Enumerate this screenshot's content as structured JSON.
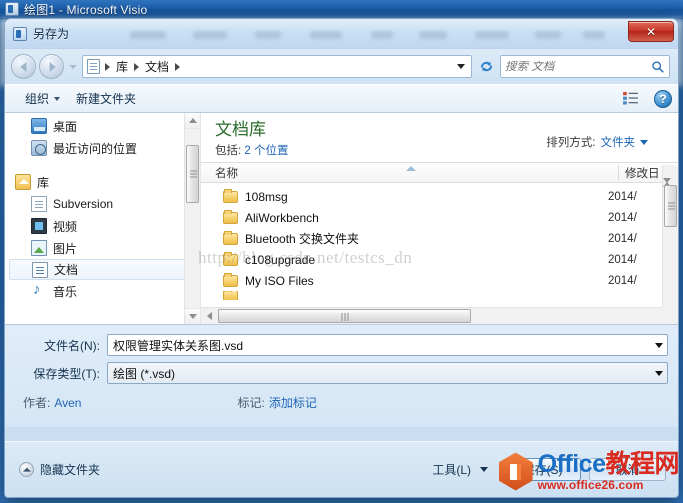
{
  "background_window": {
    "title": "绘图1 - Microsoft Visio",
    "icon": "visio-app-icon"
  },
  "dialog": {
    "title": "另存为",
    "icon": "visio-app-icon",
    "close_label": "✕"
  },
  "navbar": {
    "back_icon": "back-arrow-icon",
    "forward_icon": "forward-arrow-icon",
    "history_icon": "chevron-down-icon",
    "path_icon": "library-document-icon",
    "breadcrumbs": [
      "库",
      "文档"
    ],
    "dropdown_icon": "chevron-down-icon",
    "refresh_icon": "refresh-icon",
    "search": {
      "placeholder": "搜索 文档",
      "value": "",
      "icon": "search-icon"
    }
  },
  "commandbar": {
    "organize_label": "组织",
    "new_folder_label": "新建文件夹",
    "view_icon": "view-layout-icon",
    "view_caret_icon": "chevron-down-icon",
    "help_label": "?",
    "help_icon": "help-icon"
  },
  "sidebar": {
    "items": [
      {
        "label": "桌面",
        "icon": "desktop-icon",
        "type": "item",
        "selected": false
      },
      {
        "label": "最近访问的位置",
        "icon": "recent-places-icon",
        "type": "item",
        "selected": false
      },
      {
        "label": "",
        "icon": "",
        "type": "spacer",
        "selected": false
      },
      {
        "label": "库",
        "icon": "library-icon",
        "type": "group",
        "selected": false
      },
      {
        "label": "Subversion",
        "icon": "subversion-icon",
        "type": "item",
        "selected": false
      },
      {
        "label": "视频",
        "icon": "video-icon",
        "type": "item",
        "selected": false
      },
      {
        "label": "图片",
        "icon": "picture-icon",
        "type": "item",
        "selected": false
      },
      {
        "label": "文档",
        "icon": "document-icon",
        "type": "item",
        "selected": true
      },
      {
        "label": "音乐",
        "icon": "music-icon",
        "type": "item",
        "selected": false
      }
    ]
  },
  "filelist": {
    "library_title": "文档库",
    "includes_prefix": "包括:",
    "includes_link": "2 个位置",
    "arrange_label": "排列方式:",
    "arrange_value": "文件夹",
    "arrange_caret_icon": "chevron-down-icon",
    "columns": [
      {
        "label": "名称"
      },
      {
        "label": "修改日"
      }
    ],
    "rows": [
      {
        "name": "108msg",
        "date": "2014/",
        "icon": "folder-icon"
      },
      {
        "name": "AliWorkbench",
        "date": "2014/",
        "icon": "folder-icon"
      },
      {
        "name": "Bluetooth 交换文件夹",
        "date": "2014/",
        "icon": "folder-icon"
      },
      {
        "name": "c108upgrade",
        "date": "2014/",
        "icon": "folder-icon"
      },
      {
        "name": "My ISO Files",
        "date": "2014/",
        "icon": "folder-icon"
      }
    ],
    "scroll_up_icon": "scroll-up-icon",
    "scroll_down_icon": "scroll-down-icon",
    "scroll_left_icon": "scroll-left-icon",
    "scroll_right_icon": "scroll-right-icon"
  },
  "form": {
    "filename_label": "文件名(N):",
    "filename_value": "权限管理实体关系图.vsd",
    "filetype_label": "保存类型(T):",
    "filetype_value": "绘图 (*.vsd)",
    "author_label": "作者:",
    "author_value": "Aven",
    "tags_label": "标记:",
    "tags_value": "添加标记"
  },
  "footer": {
    "hide_folders_label": "隐藏文件夹",
    "hide_folders_icon": "chevron-up-circle-icon",
    "tools_label": "工具(L)",
    "tools_caret_icon": "chevron-down-icon",
    "save_label": "保存(S)",
    "cancel_label": "取消"
  },
  "watermarks": {
    "csdn": "http://blog.csdn.net/testcs_dn",
    "office_main_blue": "Office",
    "office_main_red": "教程网",
    "office_sub": "www.office26.com",
    "office_logo_icon": "office-hexagon-logo-icon"
  },
  "colors": {
    "title_blue": "#1a5da6",
    "close_red": "#c8372a",
    "link_blue": "#1f66b5",
    "library_green": "#2a6d2a",
    "folder_yellow": "#f5cf6a",
    "watermark_red": "#d92b1f"
  }
}
